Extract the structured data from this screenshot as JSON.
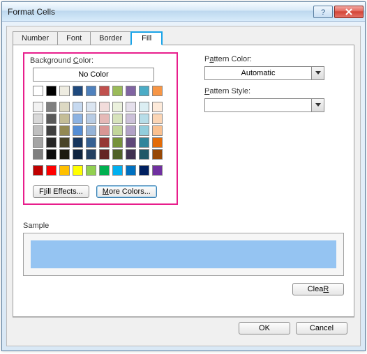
{
  "window": {
    "title": "Format Cells"
  },
  "tabs": [
    {
      "label": "Number"
    },
    {
      "label": "Font"
    },
    {
      "label": "Border"
    },
    {
      "label": "Fill",
      "active": true
    }
  ],
  "fill": {
    "bg_label_pre": "Background ",
    "bg_label_hot": "C",
    "bg_label_post": "olor:",
    "no_color": "No Color",
    "fill_effects_hot": "I",
    "fill_effects_rest": "ill Effects...",
    "fill_effects_pre": "F",
    "more_colors_hot": "M",
    "more_colors_rest": "ore Colors...",
    "theme_row1": [
      "#FFFFFF",
      "#000000",
      "#EEECE1",
      "#1F497D",
      "#4F81BD",
      "#C0504D",
      "#9BBB59",
      "#8064A2",
      "#4BACC6",
      "#F79646"
    ],
    "theme_grid": [
      [
        "#F2F2F2",
        "#7F7F7F",
        "#DDD9C3",
        "#C6D9F0",
        "#DBE5F1",
        "#F2DCDB",
        "#EBF1DD",
        "#E5E0EC",
        "#DBEEF3",
        "#FDEADA"
      ],
      [
        "#D8D8D8",
        "#595959",
        "#C4BD97",
        "#8DB3E2",
        "#B8CCE4",
        "#E5B9B7",
        "#D7E3BC",
        "#CCC1D9",
        "#B7DDE8",
        "#FBD5B5"
      ],
      [
        "#BFBFBF",
        "#3F3F3F",
        "#938953",
        "#548DD4",
        "#95B3D7",
        "#D99694",
        "#C3D69B",
        "#B2A2C7",
        "#92CDDC",
        "#FAC08F"
      ],
      [
        "#A5A5A5",
        "#262626",
        "#494429",
        "#17365D",
        "#366092",
        "#953734",
        "#76923C",
        "#5F497A",
        "#31859B",
        "#E36C09"
      ],
      [
        "#7F7F7F",
        "#0C0C0C",
        "#1D1B10",
        "#0F243E",
        "#244061",
        "#632423",
        "#4F6128",
        "#3F3151",
        "#205867",
        "#974806"
      ]
    ],
    "standard_row": [
      "#C00000",
      "#FF0000",
      "#FFC000",
      "#FFFF00",
      "#92D050",
      "#00B050",
      "#00B0F0",
      "#0070C0",
      "#002060",
      "#7030A0"
    ]
  },
  "pattern": {
    "color_label_pre": "P",
    "color_label_hot": "a",
    "color_label_post": "ttern Color:",
    "color_value": "Automatic",
    "style_label_hot": "P",
    "style_label_rest": "attern Style:",
    "style_value": ""
  },
  "sample": {
    "label": "Sample",
    "color": "#95c4f2"
  },
  "buttons": {
    "clear_hot": "R",
    "clear_pre": "Clea",
    "ok": "OK",
    "cancel": "Cancel"
  }
}
